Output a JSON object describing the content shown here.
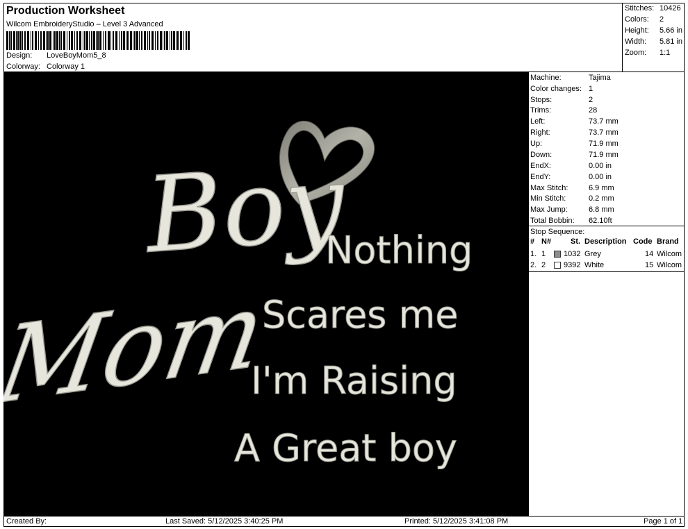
{
  "header": {
    "title": "Production Worksheet",
    "software": "Wilcom EmbroideryStudio – Level 3 Advanced",
    "design_label": "Design:",
    "design_value": "LoveBoyMom5_8",
    "colorway_label": "Colorway:",
    "colorway_value": "Colorway 1"
  },
  "summary": [
    {
      "label": "Stitches:",
      "value": "10426"
    },
    {
      "label": "Colors:",
      "value": "2"
    },
    {
      "label": "Height:",
      "value": "5.66 in"
    },
    {
      "label": "Width:",
      "value": "5.81 in"
    },
    {
      "label": "Zoom:",
      "value": "1:1"
    }
  ],
  "machine": [
    {
      "label": "Machine:",
      "value": "Tajima"
    },
    {
      "label": "Color changes:",
      "value": "1"
    },
    {
      "label": "Stops:",
      "value": "2"
    },
    {
      "label": "Trims:",
      "value": "28"
    },
    {
      "label": "Left:",
      "value": "73.7 mm"
    },
    {
      "label": "Right:",
      "value": "73.7 mm"
    },
    {
      "label": "Up:",
      "value": "71.9 mm"
    },
    {
      "label": "Down:",
      "value": "71.9 mm"
    },
    {
      "label": "EndX:",
      "value": "0.00 in"
    },
    {
      "label": "EndY:",
      "value": "0.00 in"
    },
    {
      "label": "Max Stitch:",
      "value": "6.9 mm"
    },
    {
      "label": "Min Stitch:",
      "value": "0.2 mm"
    },
    {
      "label": "Max Jump:",
      "value": "6.8 mm"
    },
    {
      "label": "Total Bobbin:",
      "value": "62.10ft"
    }
  ],
  "stop_sequence": {
    "title": "Stop Sequence:",
    "headers": {
      "num": "#",
      "n": "N#",
      "st": "St.",
      "desc": "Description",
      "code": "Code",
      "brand": "Brand"
    },
    "rows": [
      {
        "num": "1.",
        "n": "1",
        "color": "#8c8c8c",
        "st": "1032",
        "desc": "Grey",
        "code": "14",
        "brand": "Wilcom"
      },
      {
        "num": "2.",
        "n": "2",
        "color": "#ffffff",
        "st": "9392",
        "desc": "White",
        "code": "15",
        "brand": "Wilcom"
      }
    ]
  },
  "design_text": {
    "boy": "Boy",
    "mom": "Mom",
    "line1": "Nothing",
    "line2": "Scares me",
    "line3": "I'm Raising",
    "line4": "A Great boy",
    "thread_white": "#e6e6dc",
    "thread_grey": "#a4a49a",
    "background": "#000000"
  },
  "footer": {
    "created_by": "Created By:",
    "last_saved": "Last Saved: 5/12/2025 3:40:25 PM",
    "printed": "Printed: 5/12/2025 3:41:08 PM",
    "page": "Page 1 of 1"
  }
}
